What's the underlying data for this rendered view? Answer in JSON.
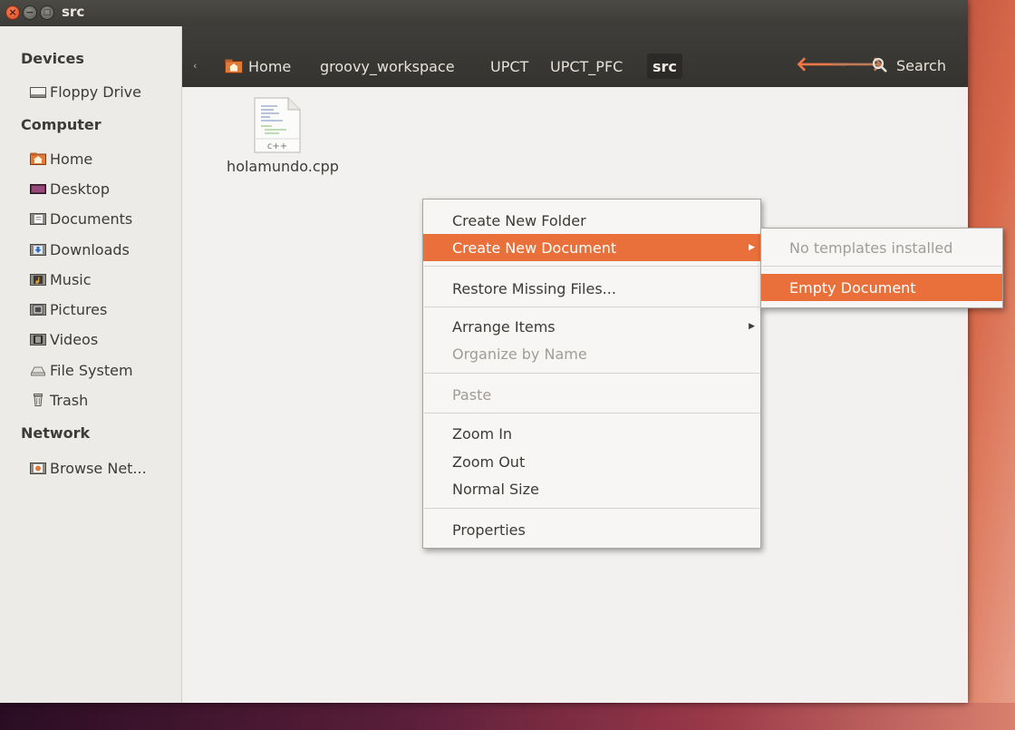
{
  "window": {
    "title": "src",
    "close_glyph": "×",
    "minimize_glyph": "−",
    "maximize_glyph": "□"
  },
  "sidebar": {
    "sections": [
      {
        "header": "Devices",
        "items": [
          {
            "label": "Floppy Drive",
            "icon": "floppy-drive-icon"
          }
        ]
      },
      {
        "header": "Computer",
        "items": [
          {
            "label": "Home",
            "icon": "home-folder-icon"
          },
          {
            "label": "Desktop",
            "icon": "desktop-icon"
          },
          {
            "label": "Documents",
            "icon": "documents-folder-icon"
          },
          {
            "label": "Downloads",
            "icon": "downloads-folder-icon"
          },
          {
            "label": "Music",
            "icon": "music-folder-icon"
          },
          {
            "label": "Pictures",
            "icon": "pictures-folder-icon"
          },
          {
            "label": "Videos",
            "icon": "videos-folder-icon"
          },
          {
            "label": "File System",
            "icon": "file-system-icon"
          },
          {
            "label": "Trash",
            "icon": "trash-icon"
          }
        ]
      },
      {
        "header": "Network",
        "items": [
          {
            "label": "Browse Net...",
            "icon": "browse-network-icon"
          }
        ]
      }
    ]
  },
  "breadcrumb": {
    "back_glyph": "‹",
    "items": [
      "Home",
      "groovy_workspace",
      "UPCT",
      "UPCT_PFC",
      "src"
    ],
    "active": "src"
  },
  "toolbar": {
    "back_arrow": "🡐",
    "forward_arrow": "🡒",
    "search_label": "Search",
    "arrow_color": "#f07746"
  },
  "files": [
    {
      "name": "holamundo.cpp",
      "type_label": "c++"
    }
  ],
  "context_menu": {
    "items": [
      {
        "label": "Create New Folder",
        "enabled": true
      },
      {
        "label": "Create New Document",
        "enabled": true,
        "highlighted": true,
        "submenu": true
      },
      {
        "label": "Restore Missing Files...",
        "enabled": true
      },
      {
        "label": "Arrange Items",
        "enabled": true,
        "submenu": true
      },
      {
        "label": "Organize by Name",
        "enabled": false
      },
      {
        "label": "Paste",
        "enabled": false
      },
      {
        "label": "Zoom In",
        "enabled": true
      },
      {
        "label": "Zoom Out",
        "enabled": true
      },
      {
        "label": "Normal Size",
        "enabled": true
      },
      {
        "label": "Properties",
        "enabled": true
      }
    ],
    "submenu_arrow": "▶"
  },
  "submenu": {
    "items": [
      {
        "label": "No templates installed",
        "enabled": false
      },
      {
        "label": "Empty Document",
        "enabled": true,
        "highlighted": true
      }
    ]
  },
  "colors": {
    "accent": "#e9703a",
    "titlebar": "#3c3b37"
  }
}
